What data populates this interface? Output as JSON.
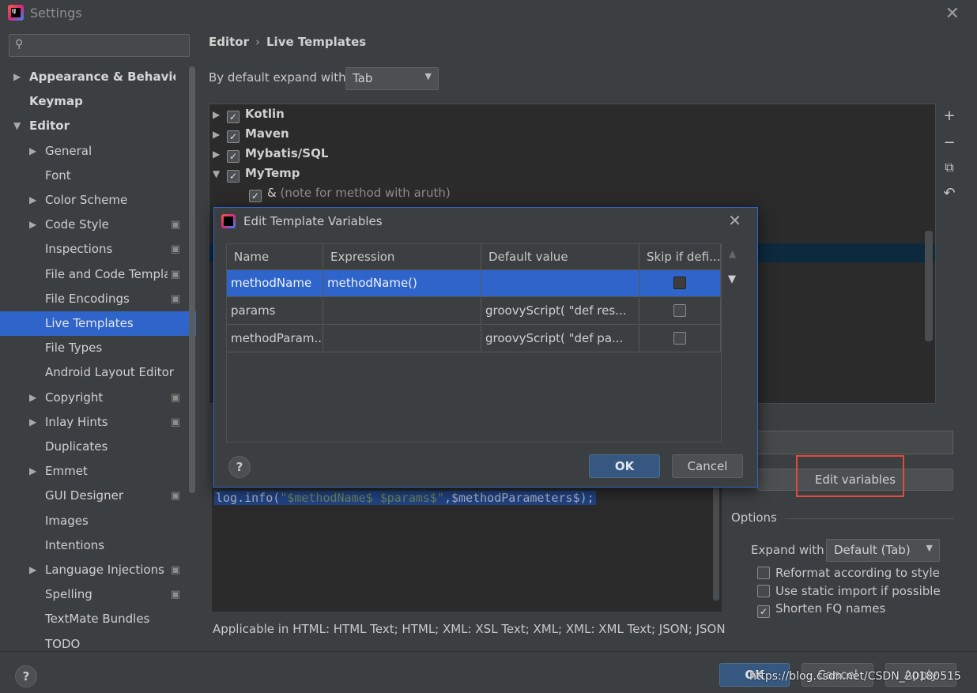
{
  "window": {
    "title": "Settings",
    "icon_label": "IJ"
  },
  "search": {
    "placeholder": "",
    "value": ""
  },
  "sidebar": {
    "items": [
      {
        "label": "Appearance & Behavior",
        "level": 0,
        "arrow": "▶",
        "bold": true
      },
      {
        "label": "Keymap",
        "level": 0,
        "bold": true
      },
      {
        "label": "Editor",
        "level": 0,
        "arrow": "▼",
        "bold": true
      },
      {
        "label": "General",
        "level": 1,
        "arrow": "▶"
      },
      {
        "label": "Font",
        "level": 1
      },
      {
        "label": "Color Scheme",
        "level": 1,
        "arrow": "▶"
      },
      {
        "label": "Code Style",
        "level": 1,
        "arrow": "▶",
        "cfg": true
      },
      {
        "label": "Inspections",
        "level": 1,
        "cfg": true
      },
      {
        "label": "File and Code Templates",
        "level": 1,
        "cfg": true
      },
      {
        "label": "File Encodings",
        "level": 1,
        "cfg": true
      },
      {
        "label": "Live Templates",
        "level": 1,
        "selected": true
      },
      {
        "label": "File Types",
        "level": 1
      },
      {
        "label": "Android Layout Editor",
        "level": 1
      },
      {
        "label": "Copyright",
        "level": 1,
        "arrow": "▶",
        "cfg": true
      },
      {
        "label": "Inlay Hints",
        "level": 1,
        "arrow": "▶",
        "cfg": true
      },
      {
        "label": "Duplicates",
        "level": 1
      },
      {
        "label": "Emmet",
        "level": 1,
        "arrow": "▶"
      },
      {
        "label": "GUI Designer",
        "level": 1,
        "cfg": true
      },
      {
        "label": "Images",
        "level": 1
      },
      {
        "label": "Intentions",
        "level": 1
      },
      {
        "label": "Language Injections",
        "level": 1,
        "arrow": "▶",
        "cfg": true
      },
      {
        "label": "Spelling",
        "level": 1,
        "cfg": true
      },
      {
        "label": "TextMate Bundles",
        "level": 1
      },
      {
        "label": "TODO",
        "level": 1
      }
    ]
  },
  "main": {
    "breadcrumb": {
      "parent": "Editor",
      "separator": "›",
      "current": "Live Templates"
    },
    "expand_label": "By default expand with",
    "expand_value": "Tab",
    "tree": [
      {
        "label": "Kotlin",
        "checked": true,
        "arrow": "▶"
      },
      {
        "label": "Maven",
        "checked": true,
        "arrow": "▶"
      },
      {
        "label": "Mybatis/SQL",
        "checked": true,
        "arrow": "▶"
      },
      {
        "label": "MyTemp",
        "checked": true,
        "arrow": "▼"
      }
    ],
    "tree_child": {
      "abbr": "&",
      "note": "(note for method with aruth)"
    },
    "tools": {
      "add": "+",
      "remove": "−",
      "copy": "⧉",
      "restore": "↶"
    },
    "edit_variables": "Edit variables",
    "options": {
      "title": "Options",
      "expand_with_label": "Expand with",
      "expand_with_value": "Default (Tab)",
      "reformat": "Reformat according to style",
      "static_import": "Use static import if possible",
      "shorten_fq": "Shorten FQ names"
    },
    "code": {
      "prefix": "log.info(",
      "string": "\"$methodName$ $params$\"",
      "suffix": ",$methodParameters$);"
    },
    "applicable": "Applicable in HTML: HTML Text; HTML; XML: XSL Text; XML; XML: XML Text; JSON; JSON"
  },
  "dialog": {
    "title": "Edit Template Variables",
    "columns": [
      "Name",
      "Expression",
      "Default value",
      "Skip if defi..."
    ],
    "rows": [
      {
        "name": "methodName",
        "expression": "methodName()",
        "default": "",
        "skip": false
      },
      {
        "name": "params",
        "expression": "",
        "default": "groovyScript(    \"def res...",
        "skip": false
      },
      {
        "name": "methodParam...",
        "expression": "",
        "default": " groovyScript(    \"def pa...",
        "skip": false
      }
    ],
    "ok": "OK",
    "cancel": "Cancel"
  },
  "footer": {
    "ok": "OK",
    "cancel": "Cancel",
    "apply": "Apply"
  },
  "watermark": "https://blog.csdn.net/CSDN_20180515",
  "colors": {
    "selection": "#2f65ca",
    "primary_button": "#365880",
    "highlight_box": "#e14a3c"
  }
}
